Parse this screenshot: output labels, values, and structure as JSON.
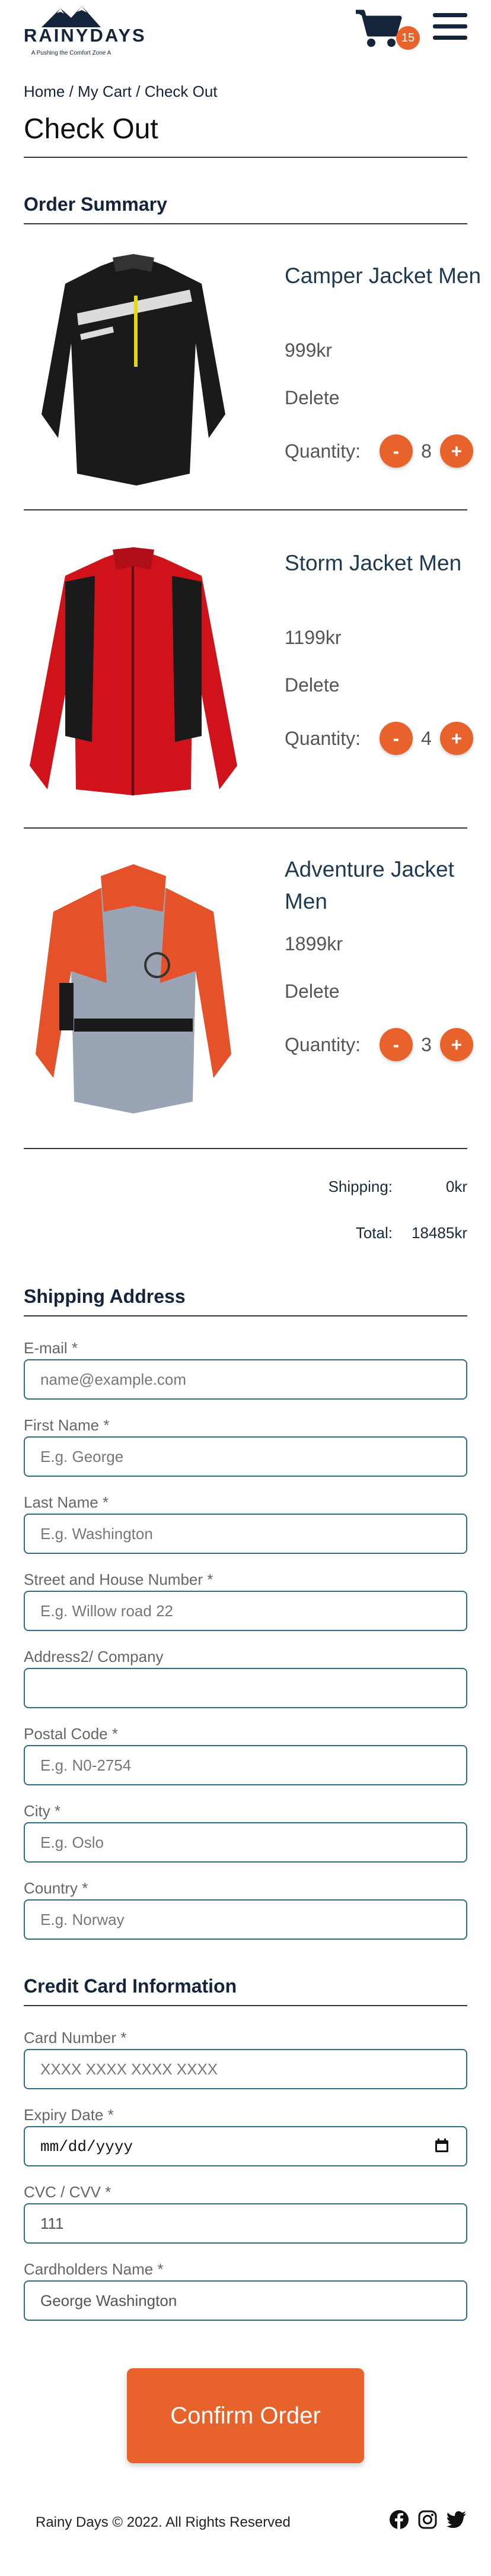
{
  "header": {
    "logo_title": "RAINYDAYS",
    "logo_tagline": "A Pushing the Comfort Zone A",
    "cart_count": "15",
    "cart_icon": "shopping-cart-icon",
    "menu_icon": "hamburger-menu-icon"
  },
  "breadcrumb": {
    "home": "Home",
    "sep1": " / ",
    "cart": "My Cart",
    "sep2": " / ",
    "current": "Check Out"
  },
  "page_title": "Check Out",
  "order_summary": {
    "title": "Order Summary",
    "items": [
      {
        "name": "Camper Jacket Men",
        "price": "999kr",
        "delete": "Delete",
        "quantity_label": "Quantity:",
        "quantity": "8",
        "minus": "-",
        "plus": "+",
        "jacket_color": "#1a1a1a",
        "accent_color": "#e8e8e8"
      },
      {
        "name": "Storm Jacket Men",
        "price": "1199kr",
        "delete": "Delete",
        "quantity_label": "Quantity:",
        "quantity": "4",
        "minus": "-",
        "plus": "+",
        "jacket_color": "#d0121b",
        "accent_color": "#1a1a1a"
      },
      {
        "name": "Adventure Jacket Men",
        "price": "1899kr",
        "delete": "Delete",
        "quantity_label": "Quantity:",
        "quantity": "3",
        "minus": "-",
        "plus": "+",
        "jacket_color": "#e5522a",
        "accent_color": "#9aa4b4"
      }
    ],
    "shipping_label": "Shipping:",
    "shipping_value": "0kr",
    "total_label": "Total:",
    "total_value": "18485kr"
  },
  "shipping_address": {
    "title": "Shipping Address",
    "fields": [
      {
        "label": "E-mail *",
        "placeholder": "name@example.com"
      },
      {
        "label": "First Name *",
        "placeholder": "E.g. George"
      },
      {
        "label": "Last Name *",
        "placeholder": "E.g. Washington"
      },
      {
        "label": "Street and House Number *",
        "placeholder": "E.g. Willow road 22"
      },
      {
        "label": "Address2/ Company",
        "placeholder": ""
      },
      {
        "label": "Postal Code *",
        "placeholder": "E.g. N0-2754"
      },
      {
        "label": "City *",
        "placeholder": "E.g. Oslo"
      },
      {
        "label": "Country *",
        "placeholder": "E.g. Norway"
      }
    ]
  },
  "credit_card": {
    "title": "Credit Card Information",
    "card_number_label": "Card Number *",
    "card_number_placeholder": "XXXX XXXX XXXX XXXX",
    "expiry_label": "Expiry Date *",
    "expiry_placeholder": "mm/dd/yyyy",
    "cvc_label": "CVC / CVV *",
    "cvc_value": "111",
    "holder_label": "Cardholders Name *",
    "holder_value": "George Washington"
  },
  "confirm_button": "Confirm Order",
  "footer": {
    "text": "Rainy Days © 2022. All Rights Reserved",
    "socials": [
      "facebook-icon",
      "instagram-icon",
      "twitter-icon"
    ]
  },
  "colors": {
    "accent": "#e8622c",
    "brand": "#14243a",
    "input_border": "#2f6a7f"
  }
}
